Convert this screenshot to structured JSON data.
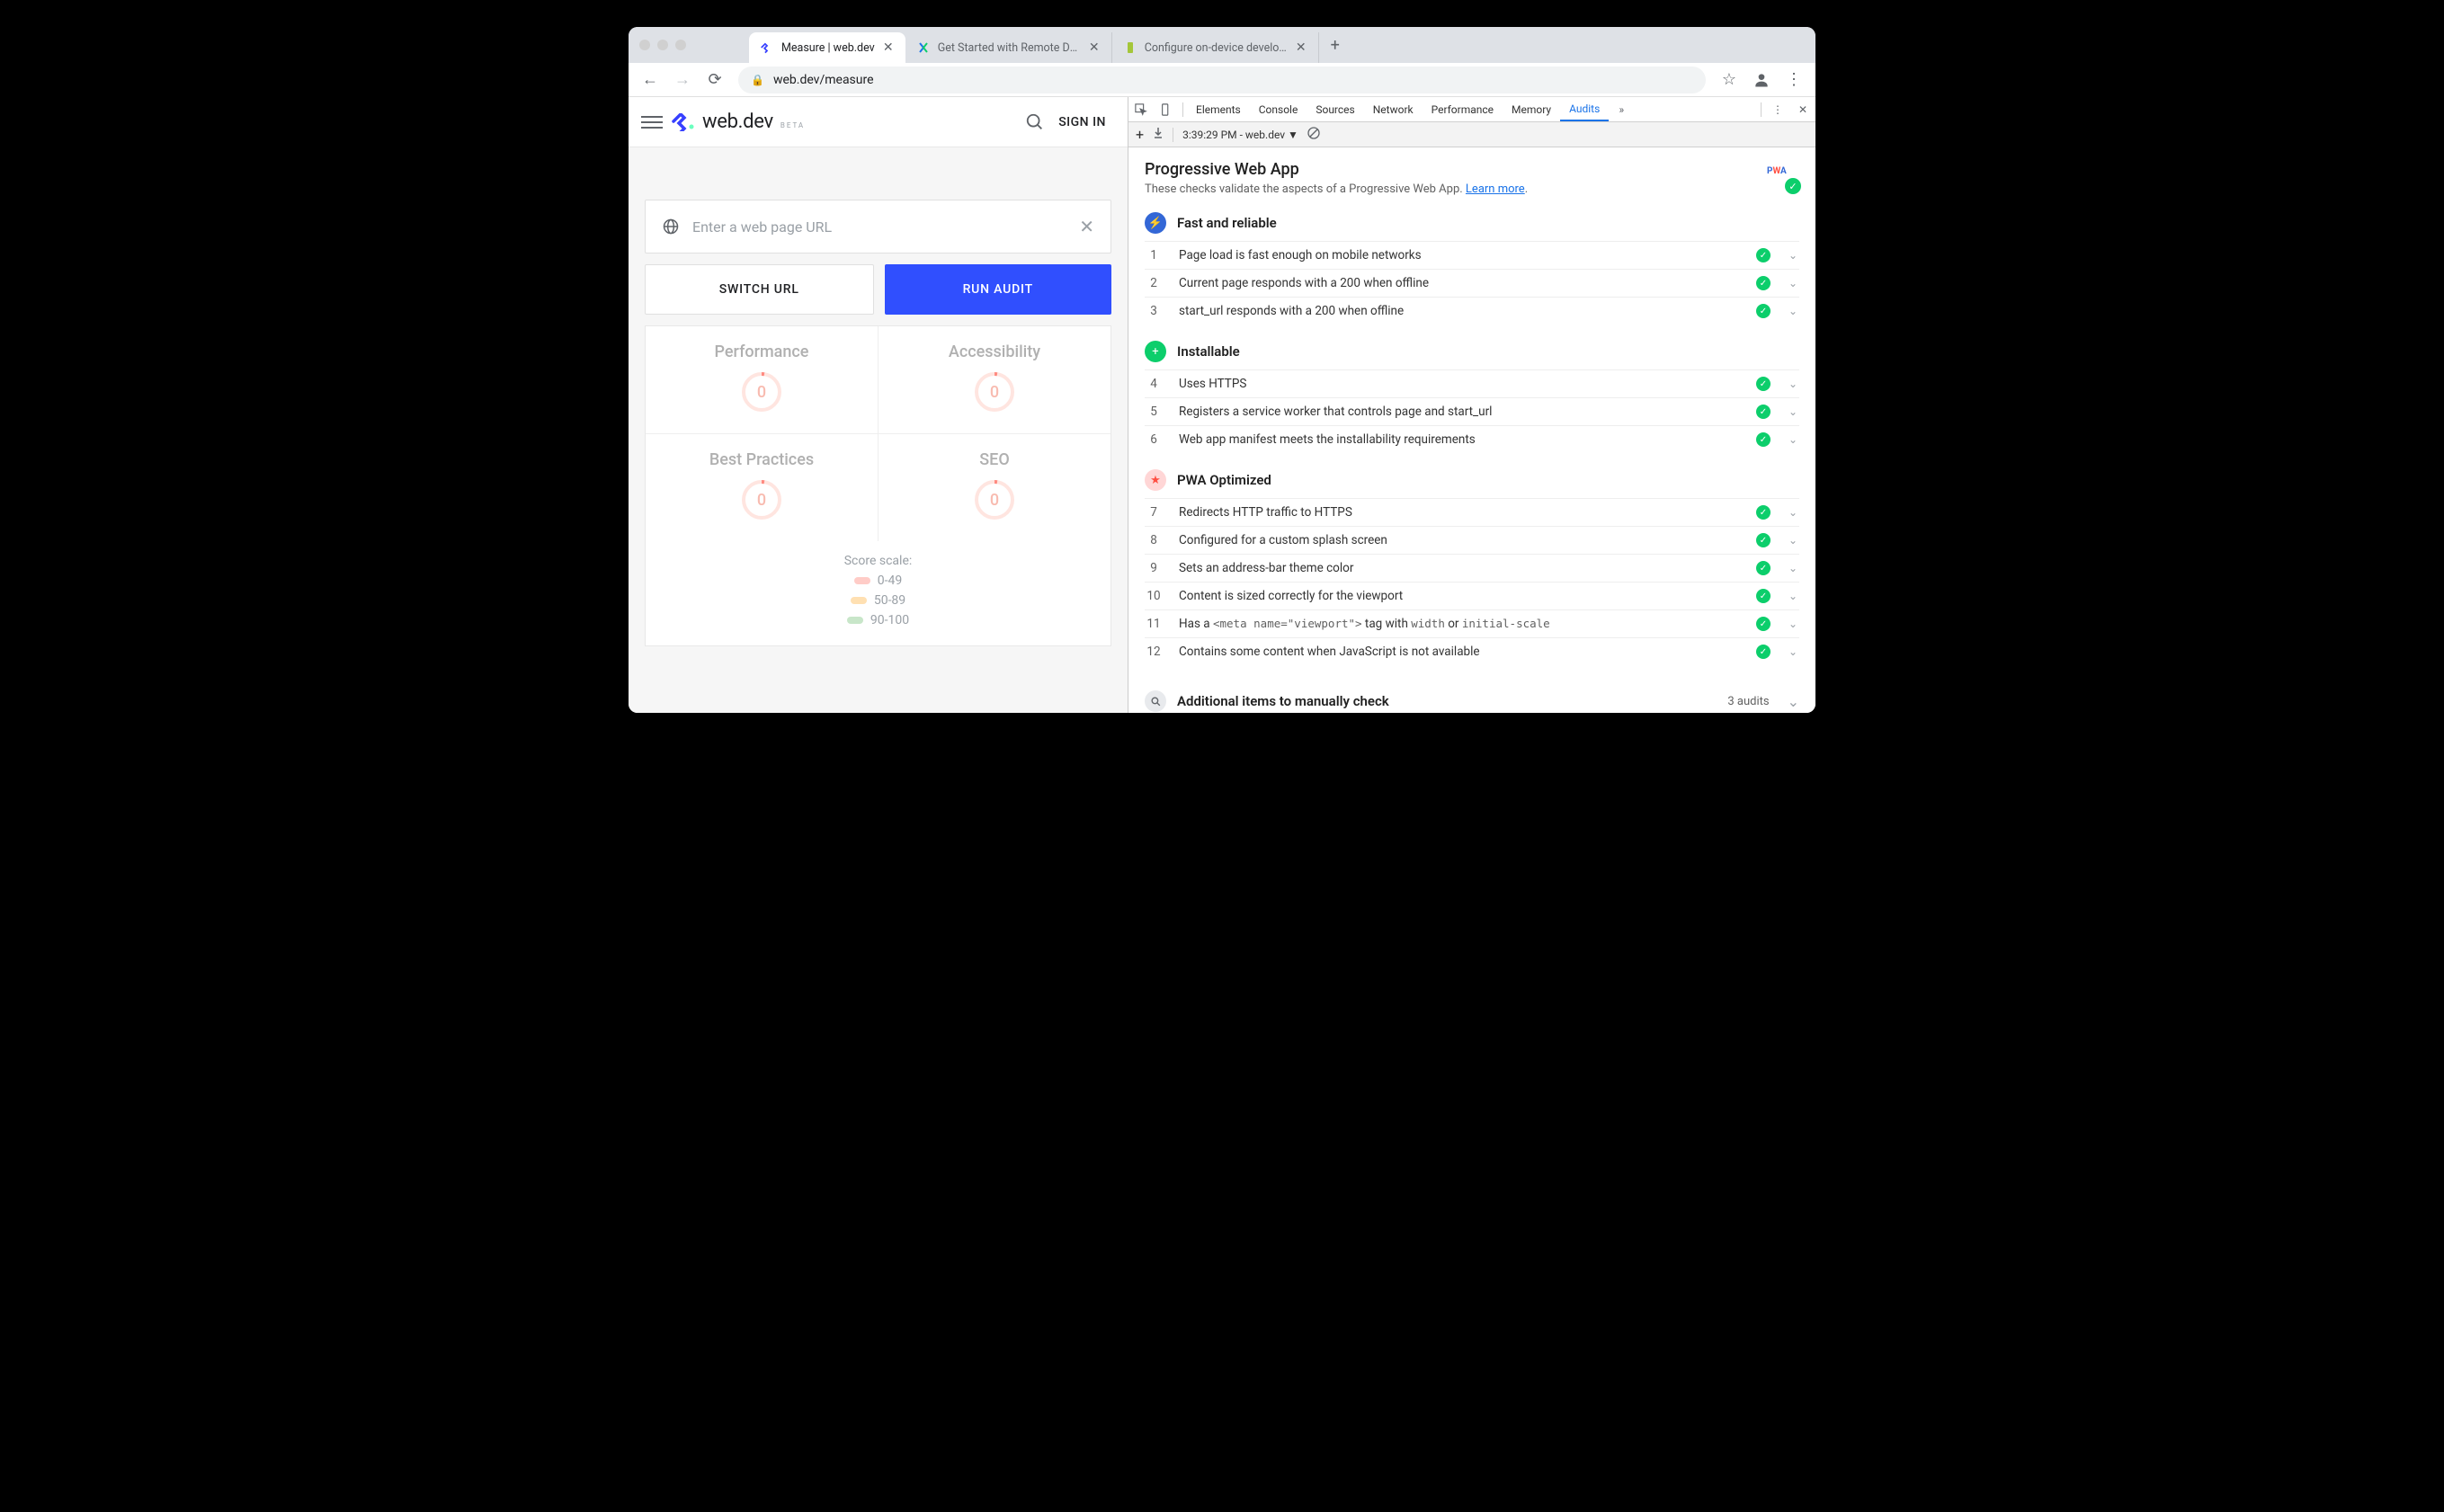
{
  "browser": {
    "tabs": [
      {
        "title": "Measure  |  web.dev",
        "active": true
      },
      {
        "title": "Get Started with Remote Debu",
        "active": false
      },
      {
        "title": "Configure on-device developer",
        "active": false
      }
    ],
    "url": "web.dev/measure"
  },
  "app": {
    "logo_text": "web.dev",
    "logo_sub": "BETA",
    "signin": "SIGN IN",
    "url_placeholder": "Enter a web page URL",
    "switch_btn": "SWITCH URL",
    "run_btn": "RUN AUDIT",
    "metrics": [
      {
        "label": "Performance",
        "value": "0"
      },
      {
        "label": "Accessibility",
        "value": "0"
      },
      {
        "label": "Best Practices",
        "value": "0"
      },
      {
        "label": "SEO",
        "value": "0"
      }
    ],
    "legend_title": "Score scale:",
    "legend": [
      {
        "range": "0-49",
        "cls": "red"
      },
      {
        "range": "50-89",
        "cls": "org"
      },
      {
        "range": "90-100",
        "cls": "grn"
      }
    ]
  },
  "devtools": {
    "tabs": [
      "Elements",
      "Console",
      "Sources",
      "Network",
      "Performance",
      "Memory",
      "Audits"
    ],
    "active_tab": "Audits",
    "subbar": "3:39:29 PM - web.dev  ▼",
    "title": "Progressive Web App",
    "desc": "These checks validate the aspects of a Progressive Web App. ",
    "learn": "Learn more",
    "pwa_label": "PWA",
    "categories": [
      {
        "name": "Fast and reliable",
        "icon": "bolt",
        "items": [
          {
            "n": "1",
            "t": "Page load is fast enough on mobile networks"
          },
          {
            "n": "2",
            "t": "Current page responds with a 200 when offline"
          },
          {
            "n": "3",
            "t": "start_url responds with a 200 when offline"
          }
        ]
      },
      {
        "name": "Installable",
        "icon": "plus",
        "items": [
          {
            "n": "4",
            "t": "Uses HTTPS"
          },
          {
            "n": "5",
            "t": "Registers a service worker that controls page and start_url"
          },
          {
            "n": "6",
            "t": "Web app manifest meets the installability requirements"
          }
        ]
      },
      {
        "name": "PWA Optimized",
        "icon": "star",
        "items": [
          {
            "n": "7",
            "t": "Redirects HTTP traffic to HTTPS"
          },
          {
            "n": "8",
            "t": "Configured for a custom splash screen"
          },
          {
            "n": "9",
            "t": "Sets an address-bar theme color"
          },
          {
            "n": "10",
            "t": "Content is sized correctly for the viewport"
          },
          {
            "n": "11",
            "html": "Has a <code>&lt;meta name=\"viewport\"&gt;</code> tag with <code>width</code> or <code>initial-scale</code>"
          },
          {
            "n": "12",
            "t": "Contains some content when JavaScript is not available"
          }
        ]
      }
    ],
    "manual_title": "Additional items to manually check",
    "manual_count": "3 audits"
  }
}
